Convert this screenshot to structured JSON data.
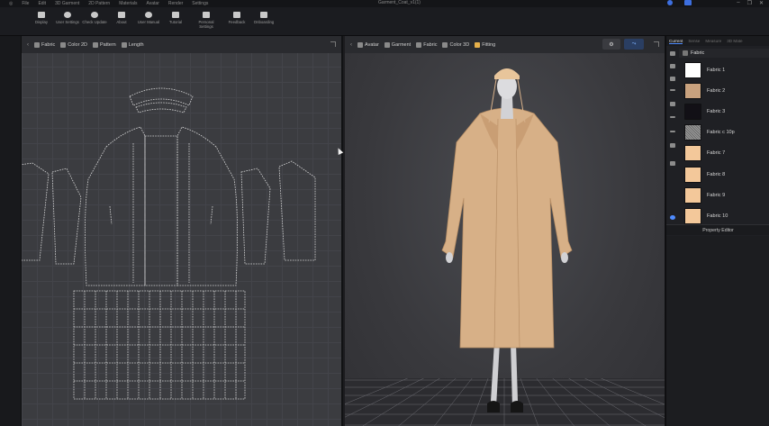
{
  "app": {
    "title": "Garment_Coat_v1(1)",
    "menu": [
      "File",
      "Edit",
      "3D Garment",
      "2D Pattern",
      "Materials",
      "Avatar",
      "Render",
      "Settings"
    ]
  },
  "toolbar": {
    "items": [
      {
        "label": "Display",
        "icon": "display-icon"
      },
      {
        "label": "User Settings",
        "icon": "gear-icon"
      },
      {
        "label": "Check Update",
        "icon": "update-icon"
      },
      {
        "label": "About",
        "icon": "info-icon"
      },
      {
        "label": "User Manual",
        "icon": "help-icon"
      },
      {
        "label": "Tutorial",
        "icon": "tutorial-icon"
      },
      {
        "label": "Personal Settings",
        "icon": "profile-icon"
      },
      {
        "label": "Feedback",
        "icon": "feedback-icon"
      },
      {
        "label": "Onboarding",
        "icon": "onboarding-icon"
      }
    ]
  },
  "view2d": {
    "chips": [
      {
        "label": "Fabric"
      },
      {
        "label": "Color 2D"
      },
      {
        "label": "Pattern"
      },
      {
        "label": "Length"
      }
    ]
  },
  "view3d": {
    "chips": [
      {
        "label": "Avatar"
      },
      {
        "label": "Garment"
      },
      {
        "label": "Fabric"
      },
      {
        "label": "Color 3D"
      },
      {
        "label": "Fitting"
      }
    ]
  },
  "rpanel": {
    "tabs": [
      "Current",
      "Sense",
      "Measure",
      "3D Mate"
    ],
    "section": "Fabric",
    "fabrics": [
      {
        "name": "Fabric 1",
        "color": "#ffffff"
      },
      {
        "name": "Fabric 2",
        "color": "#c9a27e"
      },
      {
        "name": "Fabric 3",
        "color": "#121016"
      },
      {
        "name": "Fabric c 10p",
        "color": "#8e8e8e"
      },
      {
        "name": "Fabric 7",
        "color": "#f3c89a"
      },
      {
        "name": "Fabric 8",
        "color": "#f3c89a"
      },
      {
        "name": "Fabric 9",
        "color": "#f3c89a"
      },
      {
        "name": "Fabric 10",
        "color": "#f3c89a"
      }
    ],
    "property_editor": "Property Editor"
  }
}
